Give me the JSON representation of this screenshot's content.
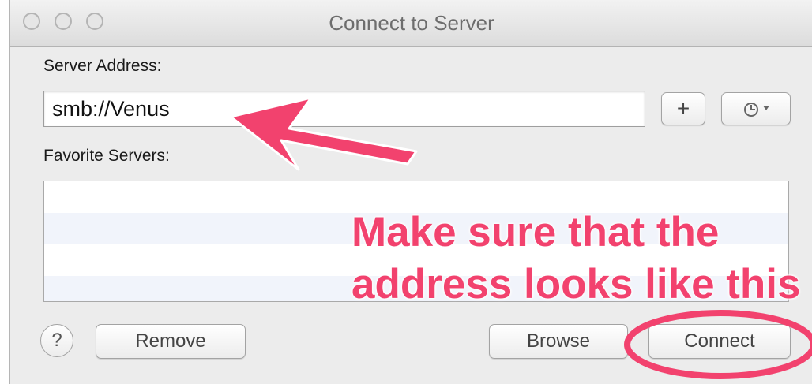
{
  "window": {
    "title": "Connect to Server"
  },
  "server_address": {
    "label": "Server Address:",
    "value": "smb://Venus"
  },
  "buttons": {
    "add": "+",
    "remove": "Remove",
    "browse": "Browse",
    "connect": "Connect",
    "help": "?"
  },
  "favorites": {
    "label": "Favorite Servers:",
    "rows": [
      "",
      "",
      "",
      ""
    ]
  },
  "annotation": {
    "line1": "Make sure that the",
    "line2": "address looks like this",
    "color": "#f2426e"
  }
}
